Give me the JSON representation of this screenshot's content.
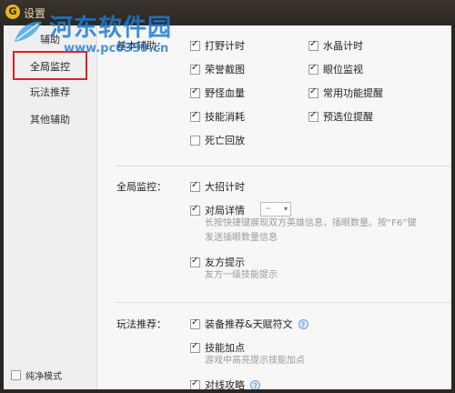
{
  "window": {
    "title": "设置",
    "logo_letter": "G"
  },
  "watermark": {
    "main": "河东软件园",
    "url": "www.pc0359.cn"
  },
  "sidebar": {
    "items": [
      {
        "label": "辅助"
      },
      {
        "label": "全局监控"
      },
      {
        "label": "玩法推荐"
      },
      {
        "label": "其他辅助"
      }
    ],
    "pure_mode_label": "纯净模式"
  },
  "sections": {
    "basic": {
      "label": "基本辅助：",
      "options": [
        {
          "label": "打野计时",
          "checked": true
        },
        {
          "label": "水晶计时",
          "checked": true
        },
        {
          "label": "荣誉截图",
          "checked": true
        },
        {
          "label": "眼位监视",
          "checked": true
        },
        {
          "label": "野怪血量",
          "checked": true
        },
        {
          "label": "常用功能提醒",
          "checked": true
        },
        {
          "label": "技能消耗",
          "checked": true
        },
        {
          "label": "预选位提醒",
          "checked": true
        },
        {
          "label": "死亡回放",
          "checked": false
        }
      ]
    },
    "global": {
      "label": "全局监控：",
      "options": [
        {
          "label": "大招计时",
          "checked": true
        },
        {
          "label": "对局详情",
          "checked": true
        },
        {
          "label": "友方提示",
          "checked": true
        }
      ],
      "detail_select": "~",
      "detail_desc_1": "长按快捷键展现双方英雄信息，插眼数量。按“F6”键",
      "detail_desc_2": "发送插眼数量信息",
      "ally_desc": "友方一级技能提示"
    },
    "play": {
      "label": "玩法推荐：",
      "options": [
        {
          "label": "装备推荐&天赋符文",
          "checked": true
        },
        {
          "label": "技能加点",
          "checked": true
        },
        {
          "label": "对线攻略",
          "checked": true
        }
      ],
      "skill_desc": "游戏中高亮提示技能加点",
      "help_glyph": "?"
    }
  }
}
